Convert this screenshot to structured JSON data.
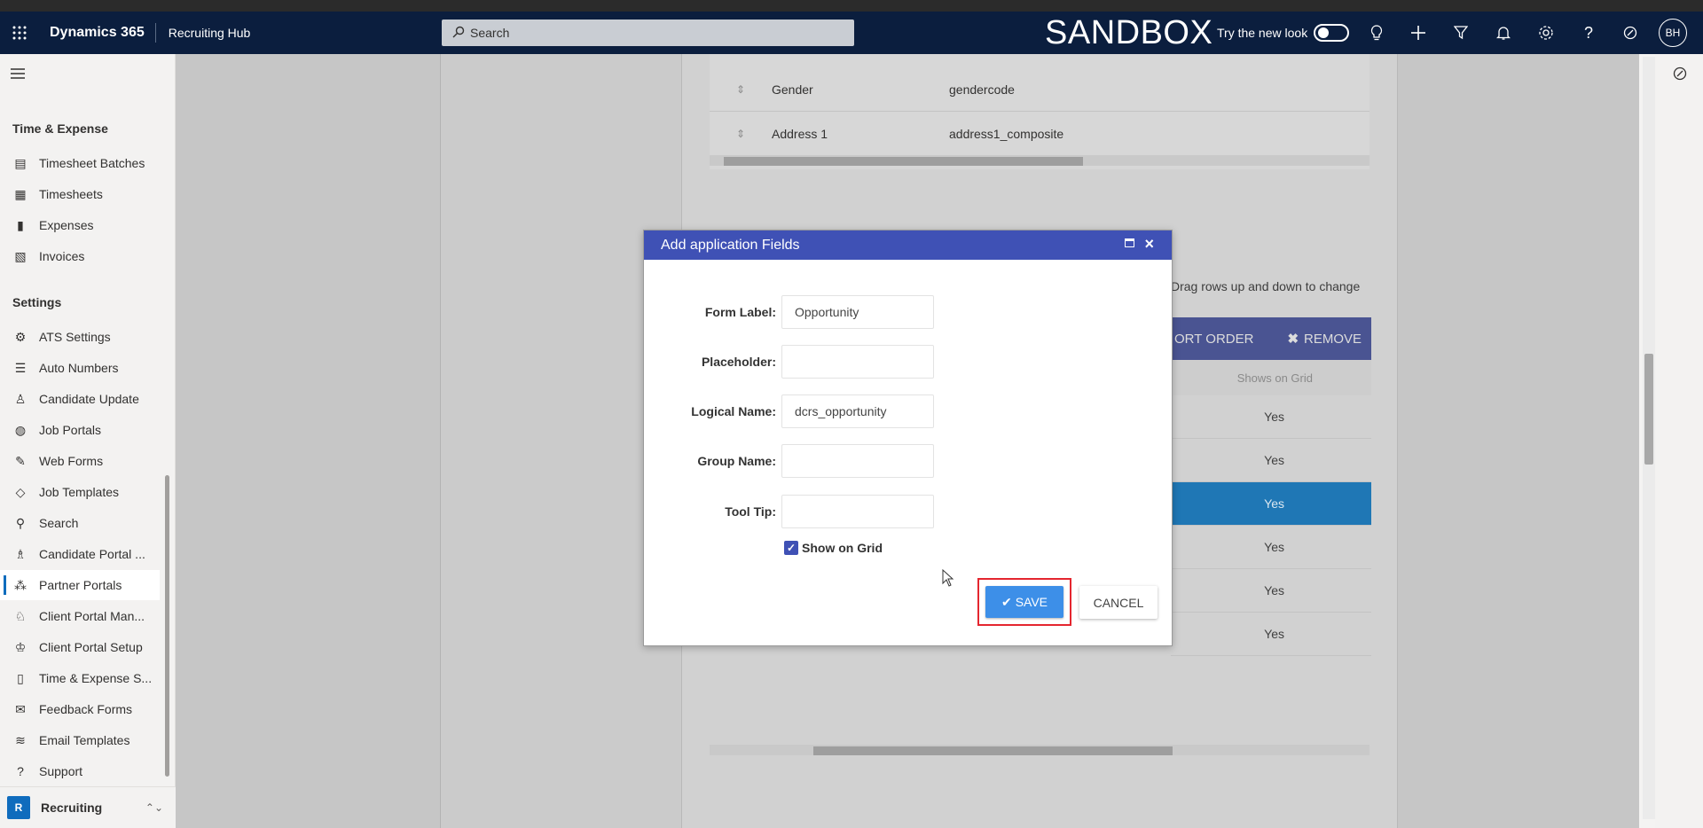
{
  "topbar": {
    "brand": "Dynamics 365",
    "app_name": "Recruiting Hub",
    "search_placeholder": "Search",
    "environment": "SANDBOX",
    "try_new_look": "Try the new look",
    "avatar_initials": "BH"
  },
  "sidebar": {
    "section_time": "Time & Expense",
    "time_items": [
      "Timesheet Batches",
      "Timesheets",
      "Expenses",
      "Invoices"
    ],
    "section_settings": "Settings",
    "settings_items": [
      "ATS Settings",
      "Auto Numbers",
      "Candidate Update",
      "Job Portals",
      "Web Forms",
      "Job Templates",
      "Search",
      "Candidate Portal ...",
      "Partner Portals",
      "Client Portal Man...",
      "Client Portal Setup",
      "Time & Expense S...",
      "Feedback Forms",
      "Email Templates",
      "Support"
    ],
    "active_item": "Partner Portals",
    "area_letter": "R",
    "area_label": "Recruiting"
  },
  "background_grid": {
    "top_rows": [
      {
        "label": "Gender",
        "logical": "gendercode"
      },
      {
        "label": "Address 1",
        "logical": "address1_composite"
      }
    ],
    "drag_hint": "Drag rows up and down to change",
    "sort_order_label": "ORT ORDER",
    "remove_label": "REMOVE",
    "shows_on_grid_header": "Shows on Grid",
    "shows_on_grid_values": [
      "Yes",
      "Yes",
      "Yes",
      "Yes",
      "Yes",
      "Yes"
    ]
  },
  "dialog": {
    "title": "Add application Fields",
    "fields": [
      {
        "label": "Form Label:",
        "value": "Opportunity"
      },
      {
        "label": "Placeholder:",
        "value": ""
      },
      {
        "label": "Logical Name:",
        "value": "dcrs_opportunity"
      },
      {
        "label": "Group Name:",
        "value": ""
      },
      {
        "label": "Tool Tip:",
        "value": ""
      }
    ],
    "show_on_grid_label": "Show on Grid",
    "show_on_grid_checked": true,
    "save_label": "SAVE",
    "cancel_label": "CANCEL"
  },
  "colors": {
    "topbar": "#0b1e3e",
    "dialog_header": "#3f51b5",
    "save_button": "#3d8fe8",
    "highlight_box": "#e4262f",
    "selected_row": "#1f77b5"
  }
}
